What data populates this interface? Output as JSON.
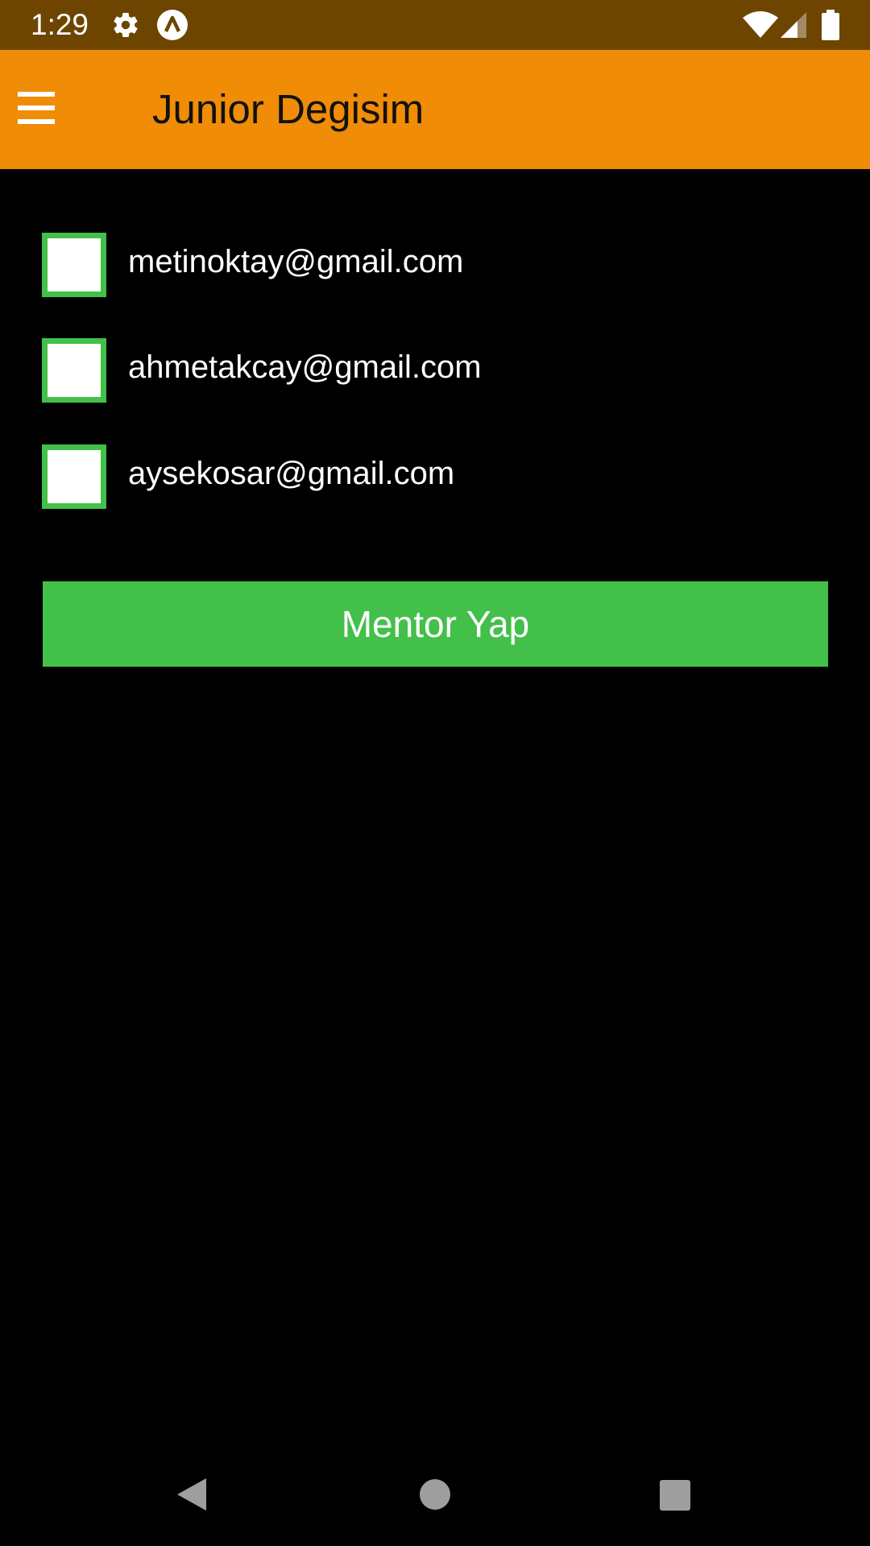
{
  "status_bar": {
    "time": "1:29",
    "background_color": "#6e4500",
    "icons": [
      "gear-icon",
      "app-notification-icon",
      "wifi-icon",
      "signal-icon",
      "battery-icon"
    ]
  },
  "app_bar": {
    "title": "Junior Degisim",
    "background_color": "#f08c05",
    "menu_icon": "hamburger-menu-icon"
  },
  "checkbox_list": [
    {
      "label": "metinoktay@gmail.com",
      "checked": false
    },
    {
      "label": "ahmetakcay@gmail.com",
      "checked": false
    },
    {
      "label": "aysekosar@gmail.com",
      "checked": false
    }
  ],
  "action_button": {
    "label": "Mentor Yap",
    "color": "#42c04a"
  },
  "nav_bar": {
    "icons": [
      "back-icon",
      "home-icon",
      "recents-icon"
    ]
  }
}
